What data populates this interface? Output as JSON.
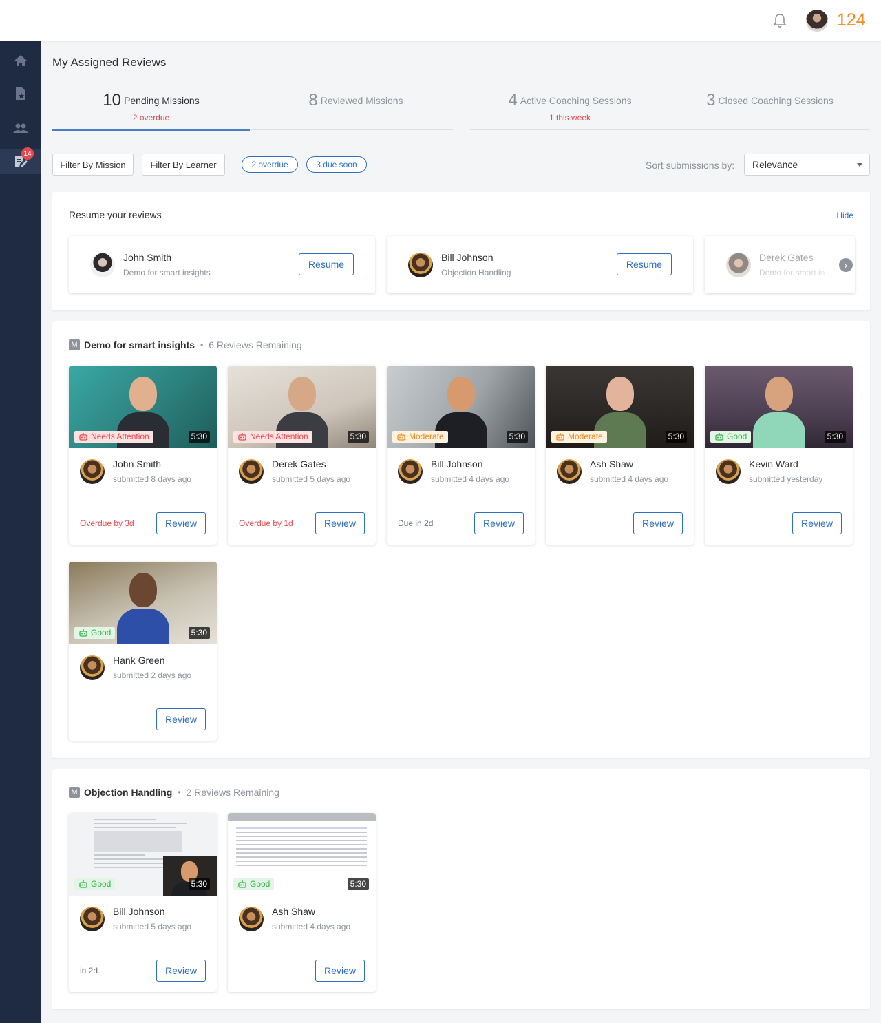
{
  "header": {
    "points": "124",
    "icons": [
      "bell-icon",
      "user-avatar"
    ]
  },
  "sidebar": {
    "items": [
      {
        "icon": "home-icon"
      },
      {
        "icon": "star-document-icon"
      },
      {
        "icon": "users-icon"
      },
      {
        "icon": "review-edit-icon",
        "badge": "14",
        "active": true
      }
    ]
  },
  "page": {
    "title": "My Assigned Reviews"
  },
  "tabs": [
    {
      "count": "10",
      "label": "Pending Missions",
      "sub": "2 overdue",
      "active": true
    },
    {
      "count": "8",
      "label": "Reviewed Missions",
      "sub": ""
    },
    {
      "count": "4",
      "label": "Active Coaching Sessions",
      "sub": "1 this week"
    },
    {
      "count": "3",
      "label": "Closed Coaching Sessions",
      "sub": ""
    }
  ],
  "filters": {
    "by_mission": "Filter By Mission",
    "by_learner": "Filter By Learner",
    "pill_overdue": "2 overdue",
    "pill_due_soon": "3 due soon",
    "sort_label": "Sort submissions by:",
    "sort_value": "Relevance"
  },
  "resume": {
    "title": "Resume your reviews",
    "hide": "Hide",
    "button": "Resume",
    "cards": [
      {
        "name": "John Smith",
        "mission": "Demo for smart insights"
      },
      {
        "name": "Bill Johnson",
        "mission": "Objection Handling"
      },
      {
        "name": "Derek Gates",
        "mission": "Demo for smart in"
      }
    ]
  },
  "missions": [
    {
      "badge": "M",
      "name": "Demo for smart insights",
      "remaining": "6 Reviews Remaining",
      "submissions": [
        {
          "tag": "Needs Attention",
          "tag_type": "attention",
          "duration": "5:30",
          "name": "John Smith",
          "when": "submitted 8 days ago",
          "status": "Overdue by 3d",
          "button": "Review"
        },
        {
          "tag": "Needs Attention",
          "tag_type": "attention",
          "duration": "5:30",
          "name": "Derek Gates",
          "when": "submitted 5 days ago",
          "status": "Overdue by 1d",
          "button": "Review"
        },
        {
          "tag": "Moderate",
          "tag_type": "moderate",
          "duration": "5:30",
          "name": "Bill Johnson",
          "when": "submitted 4 days ago",
          "status": "Due in 2d",
          "button": "Review"
        },
        {
          "tag": "Moderate",
          "tag_type": "moderate",
          "duration": "5:30",
          "name": "Ash Shaw",
          "when": "submitted 4 days ago",
          "status": "",
          "button": "Review"
        },
        {
          "tag": "Good",
          "tag_type": "good",
          "duration": "5:30",
          "name": "Kevin Ward",
          "when": "submitted yesterday",
          "status": "",
          "button": "Review"
        },
        {
          "tag": "Good",
          "tag_type": "good",
          "duration": "5:30",
          "name": "Hank Green",
          "when": "submitted 2 days ago",
          "status": "",
          "button": "Review"
        }
      ]
    },
    {
      "badge": "M",
      "name": "Objection Handling",
      "remaining": "2 Reviews Remaining",
      "submissions": [
        {
          "tag": "Good",
          "tag_type": "good",
          "duration": "5:30",
          "name": "Bill Johnson",
          "when": "submitted 5 days ago",
          "status": "in 2d",
          "button": "Review"
        },
        {
          "tag": "Good",
          "tag_type": "good",
          "duration": "5:30",
          "name": "Ash Shaw",
          "when": "submitted 4 days ago",
          "status": "",
          "button": "Review"
        }
      ]
    }
  ],
  "colors": {
    "accent": "#2f6fc2",
    "points": "#f08a24",
    "sidebar": "#1f2b42",
    "danger": "#e5484d",
    "good": "#34b24a",
    "moderate": "#f08a24"
  }
}
